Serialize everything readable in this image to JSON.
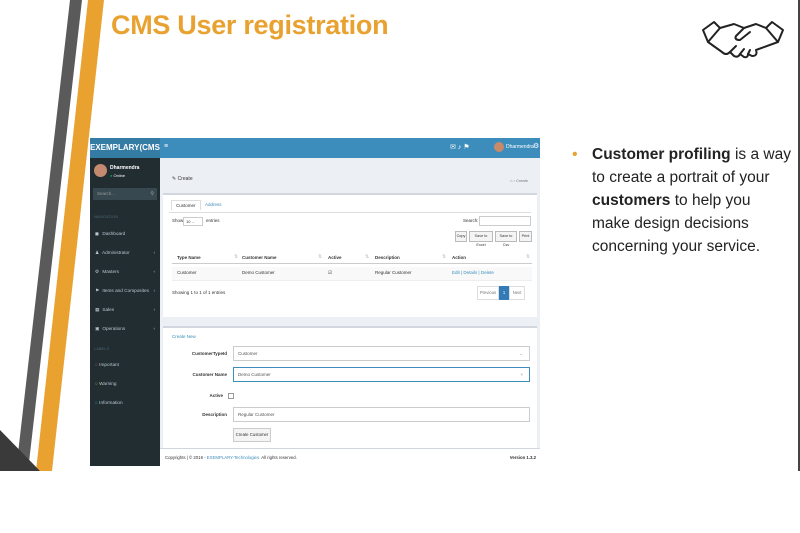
{
  "slide": {
    "title": "CMS User registration",
    "bullet": {
      "term": "Customer profiling",
      "text1": " is a way to create a portrait of your ",
      "term2": "customers",
      "text2": " to help you make design decisions concerning your service."
    },
    "colors": {
      "accent": "#E9A230",
      "dark_stripe": "#555555"
    },
    "icons": [
      "handshake-icon"
    ]
  },
  "cms": {
    "logo": "EXEMPLARY(CMS)",
    "topbar": {
      "user": "Dharmendra",
      "icons": [
        "mail-icon",
        "bell-icon",
        "flag-icon",
        "gear-icon"
      ]
    },
    "sidebar": {
      "user_name": "Dharmendra",
      "status": "Online",
      "search_placeholder": "Search...",
      "nav_header": "NAVIGATION",
      "items": [
        {
          "label": "Dashboard",
          "icon": "dashboard-icon"
        },
        {
          "label": "Administrator",
          "icon": "user-icon"
        },
        {
          "label": "Masters",
          "icon": "cogs-icon"
        },
        {
          "label": "Items and Composites",
          "icon": "flag-icon"
        },
        {
          "label": "Sales",
          "icon": "table-icon"
        },
        {
          "label": "Operations",
          "icon": "book-icon"
        }
      ],
      "labels_header": "LABELS",
      "labels": [
        {
          "label": "Important",
          "color": "#dd4b39"
        },
        {
          "label": "Warning",
          "color": "#f39c12"
        },
        {
          "label": "Information",
          "color": "#00c0ef"
        }
      ]
    },
    "page": {
      "title": "Create",
      "breadcrumb": "Create",
      "tabs": [
        "Customer",
        "Address"
      ],
      "show": "Show",
      "page_size": "10",
      "entries": "entries",
      "search_label": "Search:",
      "buttons": [
        "Copy",
        "Save to Excel",
        "Save to Csv",
        "Print"
      ],
      "table": {
        "headers": [
          "Type Name",
          "Customer Name",
          "Active",
          "Description",
          "Action"
        ],
        "rows": [
          {
            "type_name": "Customer",
            "customer_name": "Demo Customer",
            "active": "☑",
            "description": "Regular Customer",
            "action": "Edit | Details | Delete"
          }
        ]
      },
      "showing": "Showing 1 to 1 of 1 entries",
      "pagination": {
        "previous": "Previous",
        "current": "1",
        "next": "Next"
      }
    },
    "form": {
      "create_new": "Create New",
      "customer_type_label": "CustomerTypeId",
      "customer_type_value": "Customer",
      "customer_name_label": "Customer Name",
      "customer_name_value": "Demo Customer",
      "active_label": "Active",
      "description_label": "Description",
      "description_value": "Regular Customer",
      "submit": "Create Customer"
    },
    "footer": {
      "copyright": "Copyrights | © 2016 - ",
      "brand": "EXEMPLARY-Technologies.",
      "rights": " All rights reserved.",
      "version": "Version 1.3.2"
    }
  }
}
